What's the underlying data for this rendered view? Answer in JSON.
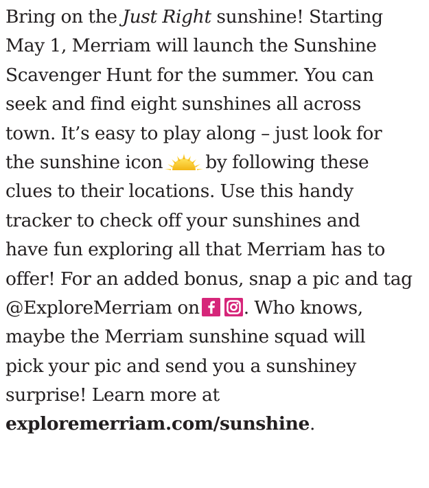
{
  "paragraph": {
    "l1_before": "Bring on the ",
    "l1_italic": "Just Right",
    "l1_after": " sunshine! Starting",
    "l2": "May 1, Merriam will launch the Sunshine",
    "l3": "Scavenger Hunt for the summer. You can",
    "l4": "seek and find eight sunshines all across",
    "l5": "town. It’s easy to play along – just look for",
    "l6_before": "the sunshine icon",
    "l6_after": "by following these",
    "l7": "clues to their locations. Use this handy",
    "l8": "tracker to check off your sunshines and",
    "l9": "have fun exploring all that Merriam has to",
    "l10": "offer! For an added bonus, snap a pic and tag",
    "l11_before": "@ExploreMerriam on",
    "l11_after": ". Who knows,",
    "l12": "maybe the Merriam sunshine squad will",
    "l13": "pick your pic and send you a sunshiney",
    "l14": "surprise! Learn more at",
    "link": "exploremerriam.com/sunshine",
    "l15_after": "."
  },
  "icons": {
    "sun": "sunshine-icon",
    "facebook": "facebook-icon",
    "instagram": "instagram-icon"
  },
  "colors": {
    "text": "#231f20",
    "sun_yellow": "#f6c61c",
    "social_magenta": "#d6267a"
  }
}
